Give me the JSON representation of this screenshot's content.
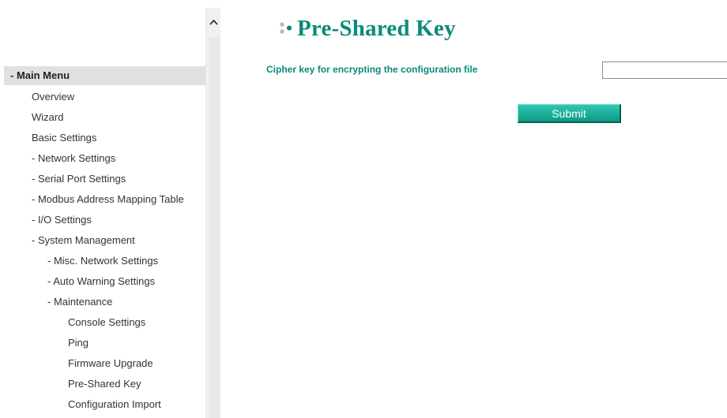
{
  "sidebar": {
    "header": "- Main Menu",
    "items": [
      {
        "label": "Overview",
        "level": 1
      },
      {
        "label": "Wizard",
        "level": 1
      },
      {
        "label": "Basic Settings",
        "level": 1
      },
      {
        "label": "- Network Settings",
        "level": 1
      },
      {
        "label": "- Serial Port Settings",
        "level": 1
      },
      {
        "label": "- Modbus Address Mapping Table",
        "level": 1
      },
      {
        "label": "- I/O Settings",
        "level": 1
      },
      {
        "label": "- System Management",
        "level": 1
      },
      {
        "label": "- Misc. Network Settings",
        "level": 2
      },
      {
        "label": "- Auto Warning Settings",
        "level": 2
      },
      {
        "label": "- Maintenance",
        "level": 2
      },
      {
        "label": "Console Settings",
        "level": 3
      },
      {
        "label": "Ping",
        "level": 3
      },
      {
        "label": "Firmware Upgrade",
        "level": 3
      },
      {
        "label": "Pre-Shared Key",
        "level": 3
      },
      {
        "label": "Configuration Import",
        "level": 3
      }
    ]
  },
  "scrollbar": {
    "up_icon": "chevron-up-icon"
  },
  "main": {
    "title_icon": "bullet-dots-icon",
    "title": "Pre-Shared Key",
    "cipher_label": "Cipher key for encrypting the configuration file",
    "cipher_value": "",
    "cipher_placeholder": "",
    "submit_label": "Submit"
  },
  "colors": {
    "accent": "#0a8a7a",
    "button_top": "#2ec7b0",
    "button_bottom": "#0c9a84",
    "menu_header_bg": "#e0e0e0"
  }
}
